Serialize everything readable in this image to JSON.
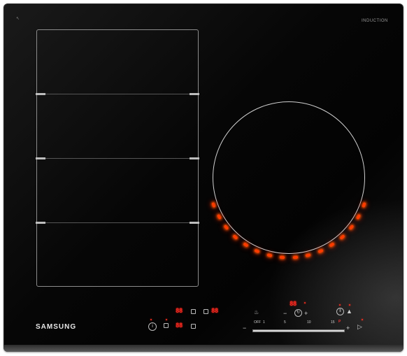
{
  "cooktop": {
    "brand": "SAMSUNG",
    "model_type": "INDUCTION",
    "corner_mark": "↖"
  },
  "zones": {
    "flex_zone_sections": 4,
    "round_zone_heat_indicators_lit": 16
  },
  "controls": {
    "left_panel": {
      "display_top_left": "88",
      "display_top_right": "88",
      "display_bottom": "88",
      "info_icon": "info-icon",
      "flex_icon": "flex-zone-icon"
    },
    "right_panel": {
      "timer_display": "88",
      "minus_label": "−",
      "plus_label": "+",
      "slider_labels": [
        "OFF",
        "1",
        "5",
        "10",
        "15",
        "P"
      ],
      "slider_level": 1.0,
      "lock_icon": "child-lock-icon",
      "pause_icon": "pause-icon",
      "power_icon": "power-icon",
      "boost_icon": "boost-icon",
      "timer_icon": "timer-icon"
    }
  }
}
